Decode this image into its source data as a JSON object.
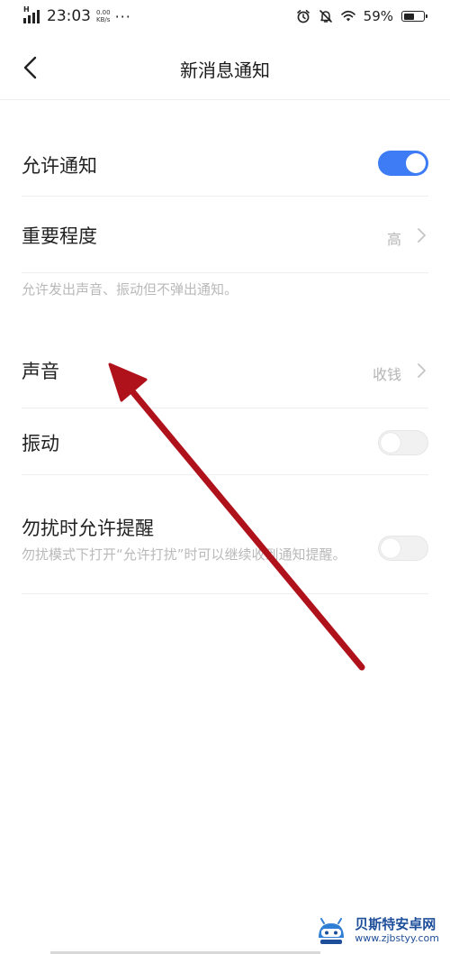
{
  "status_bar": {
    "time": "23:03",
    "net_speed_value": "0.00",
    "net_speed_unit": "KB/s",
    "more": "···",
    "battery_text": "59%",
    "battery_level": 0.59,
    "icons": [
      "signal-icon",
      "alarm-icon",
      "mute-bell-icon",
      "wifi-icon",
      "battery-icon"
    ]
  },
  "header": {
    "title": "新消息通知",
    "back_icon": "chevron-left-icon"
  },
  "settings": {
    "allow_notify": {
      "label": "允许通知",
      "enabled": true
    },
    "importance": {
      "label": "重要程度",
      "value": "高"
    },
    "importance_hint": "允许发出声音、振动但不弹出通知。",
    "sound": {
      "label": "声音",
      "value": "收钱"
    },
    "vibrate": {
      "label": "振动",
      "enabled": false
    },
    "dnd": {
      "label": "勿扰时允许提醒",
      "desc": "勿扰模式下打开“允许打扰”时可以继续收到通知提醒。",
      "enabled": false
    }
  },
  "colors": {
    "accent": "#3e7cf5",
    "annotation_arrow": "#b0121b",
    "watermark": "#1f4f9a"
  },
  "watermark": {
    "title": "贝斯特安卓网",
    "url": "www.zjbstyy.com"
  }
}
